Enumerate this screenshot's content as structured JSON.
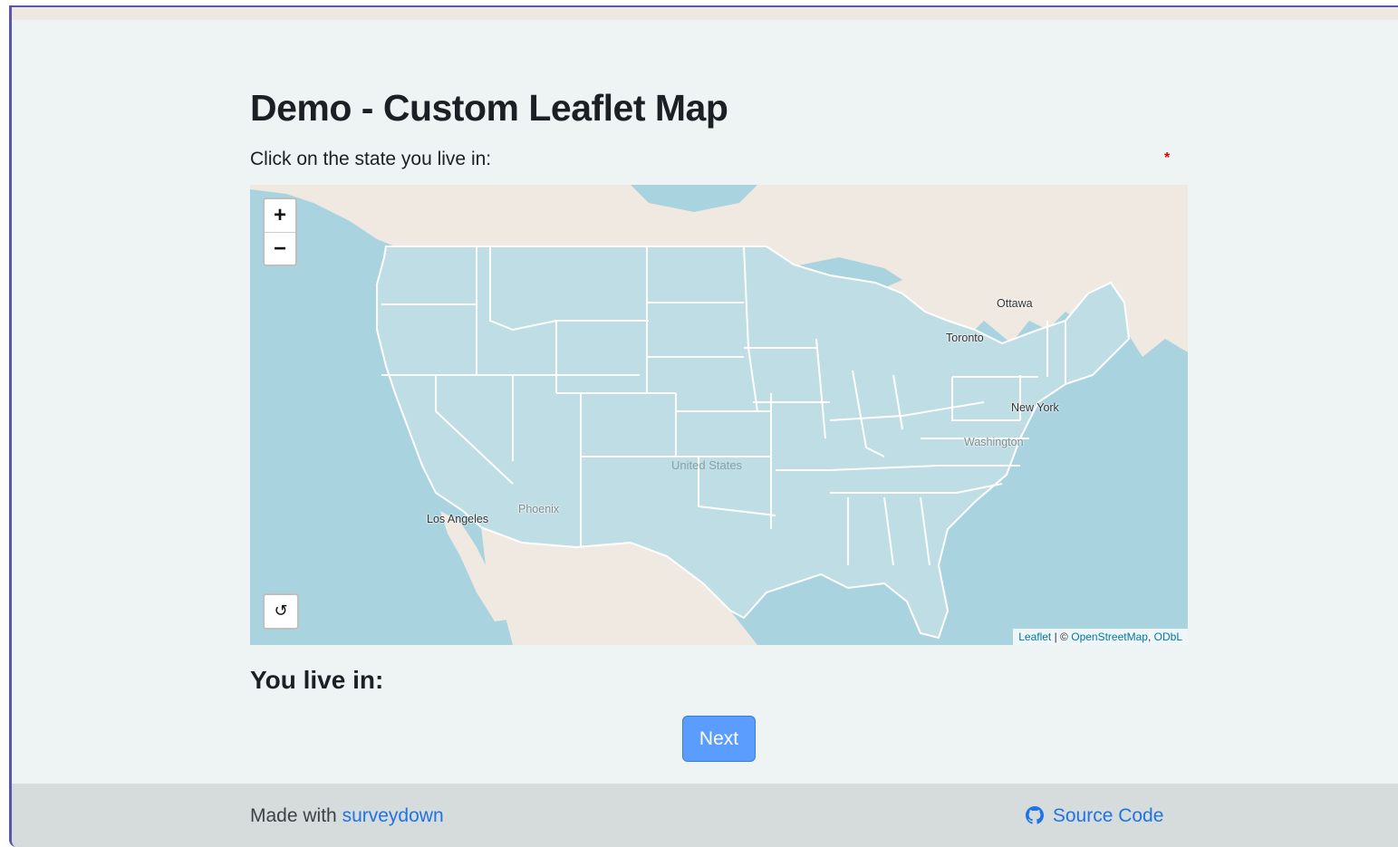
{
  "page": {
    "title": "Demo - Custom Leaflet Map",
    "question_label": "Click on the state you live in:",
    "required_marker": "*",
    "result_label": "You live in:",
    "next_button": "Next"
  },
  "map": {
    "zoom_in": "+",
    "zoom_out": "−",
    "reset_icon": "↺",
    "labels": {
      "ottawa": "Ottawa",
      "toronto": "Toronto",
      "new_york": "New York",
      "washington": "Washington",
      "united_states": "United States",
      "phoenix": "Phoenix",
      "los_angeles": "Los Angeles"
    },
    "attribution": {
      "leaflet": "Leaflet",
      "separator": "| ©",
      "osm": "OpenStreetMap",
      "comma": ",",
      "odbl": "ODbL"
    },
    "colors": {
      "water": "#a9d3df",
      "land": "#efe9e2",
      "state_fill": "#bfdde4",
      "state_border": "#ffffff"
    }
  },
  "footer": {
    "made_with": "Made with",
    "made_with_link": "surveydown",
    "source_code": "Source Code"
  }
}
